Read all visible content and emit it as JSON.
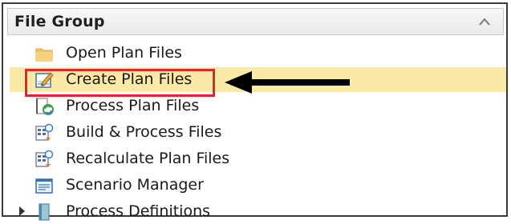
{
  "group": {
    "title": "File Group",
    "collapse_icon": "chevron-up-icon"
  },
  "items": [
    {
      "label": "Open Plan Files",
      "icon": "folder-icon",
      "selected": false
    },
    {
      "label": "Create Plan Files",
      "icon": "create-plan-icon",
      "selected": true
    },
    {
      "label": "Process Plan Files",
      "icon": "process-plan-icon",
      "selected": false
    },
    {
      "label": "Build & Process Files",
      "icon": "build-process-icon",
      "selected": false
    },
    {
      "label": "Recalculate Plan Files",
      "icon": "recalculate-icon",
      "selected": false
    },
    {
      "label": "Scenario Manager",
      "icon": "scenario-manager-icon",
      "selected": false
    },
    {
      "label": "Process Definitions",
      "icon": "process-definitions-icon",
      "selected": false,
      "expandable": true
    }
  ],
  "annotation": {
    "highlight_color": "#e0262b",
    "arrow_icon": "left-arrow-icon"
  },
  "colors": {
    "selected_row": "#fbe9a6"
  }
}
